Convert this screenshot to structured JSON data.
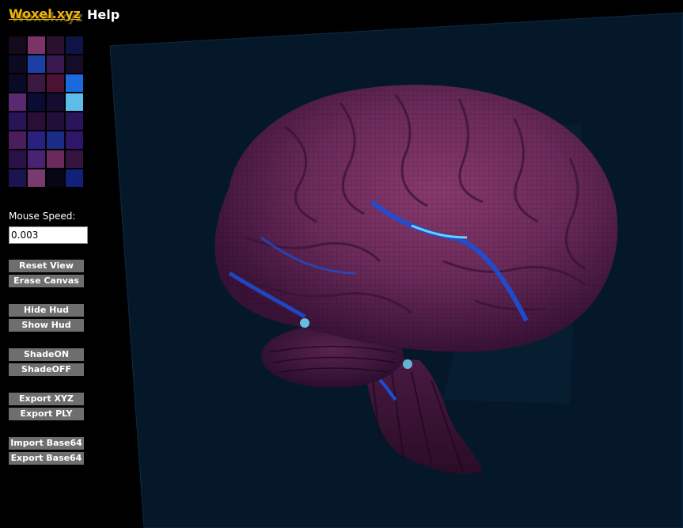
{
  "header": {
    "brand": "Woxel.xyz",
    "help": "Help"
  },
  "palette": {
    "colors": [
      "#150a1c",
      "#7a3566",
      "#2c1030",
      "#0f1447",
      "#0c0a22",
      "#1c3fa6",
      "#3a1850",
      "#160c28",
      "#0a0a26",
      "#3a1840",
      "#4c1234",
      "#1a6ade",
      "#5a2870",
      "#0a0d33",
      "#150c30",
      "#5cbcea",
      "#261454",
      "#2a0e38",
      "#220e3a",
      "#2a145a",
      "#4a1d5c",
      "#2a2080",
      "#1a2c86",
      "#2e166a",
      "#2a1248",
      "#4a2272",
      "#6a2a5c",
      "#361440",
      "#1a1450",
      "#7a3a70",
      "#060614",
      "#13207a"
    ]
  },
  "mouse_speed": {
    "label": "Mouse Speed:",
    "value": "0.003"
  },
  "buttons": {
    "reset_view": "Reset View",
    "erase_canvas": "Erase Canvas",
    "hide_hud": "Hide Hud",
    "show_hud": "Show Hud",
    "shade_on": "ShadeON",
    "shade_off": "ShadeOFF",
    "export_xyz": "Export XYZ",
    "export_ply": "Export PLY",
    "import_base64": "Import Base64",
    "export_base64": "Export Base64"
  },
  "scene": {
    "subject": "voxel-brain",
    "colors": {
      "plane": "#04182a",
      "plane_edge": "#0c2a44",
      "brain_dark": "#3a1238",
      "brain_mid": "#6a2a5a",
      "brain_light": "#8a3a6e",
      "highlight_blue": "#1a50d8",
      "highlight_cyan": "#6ad0f0"
    }
  }
}
